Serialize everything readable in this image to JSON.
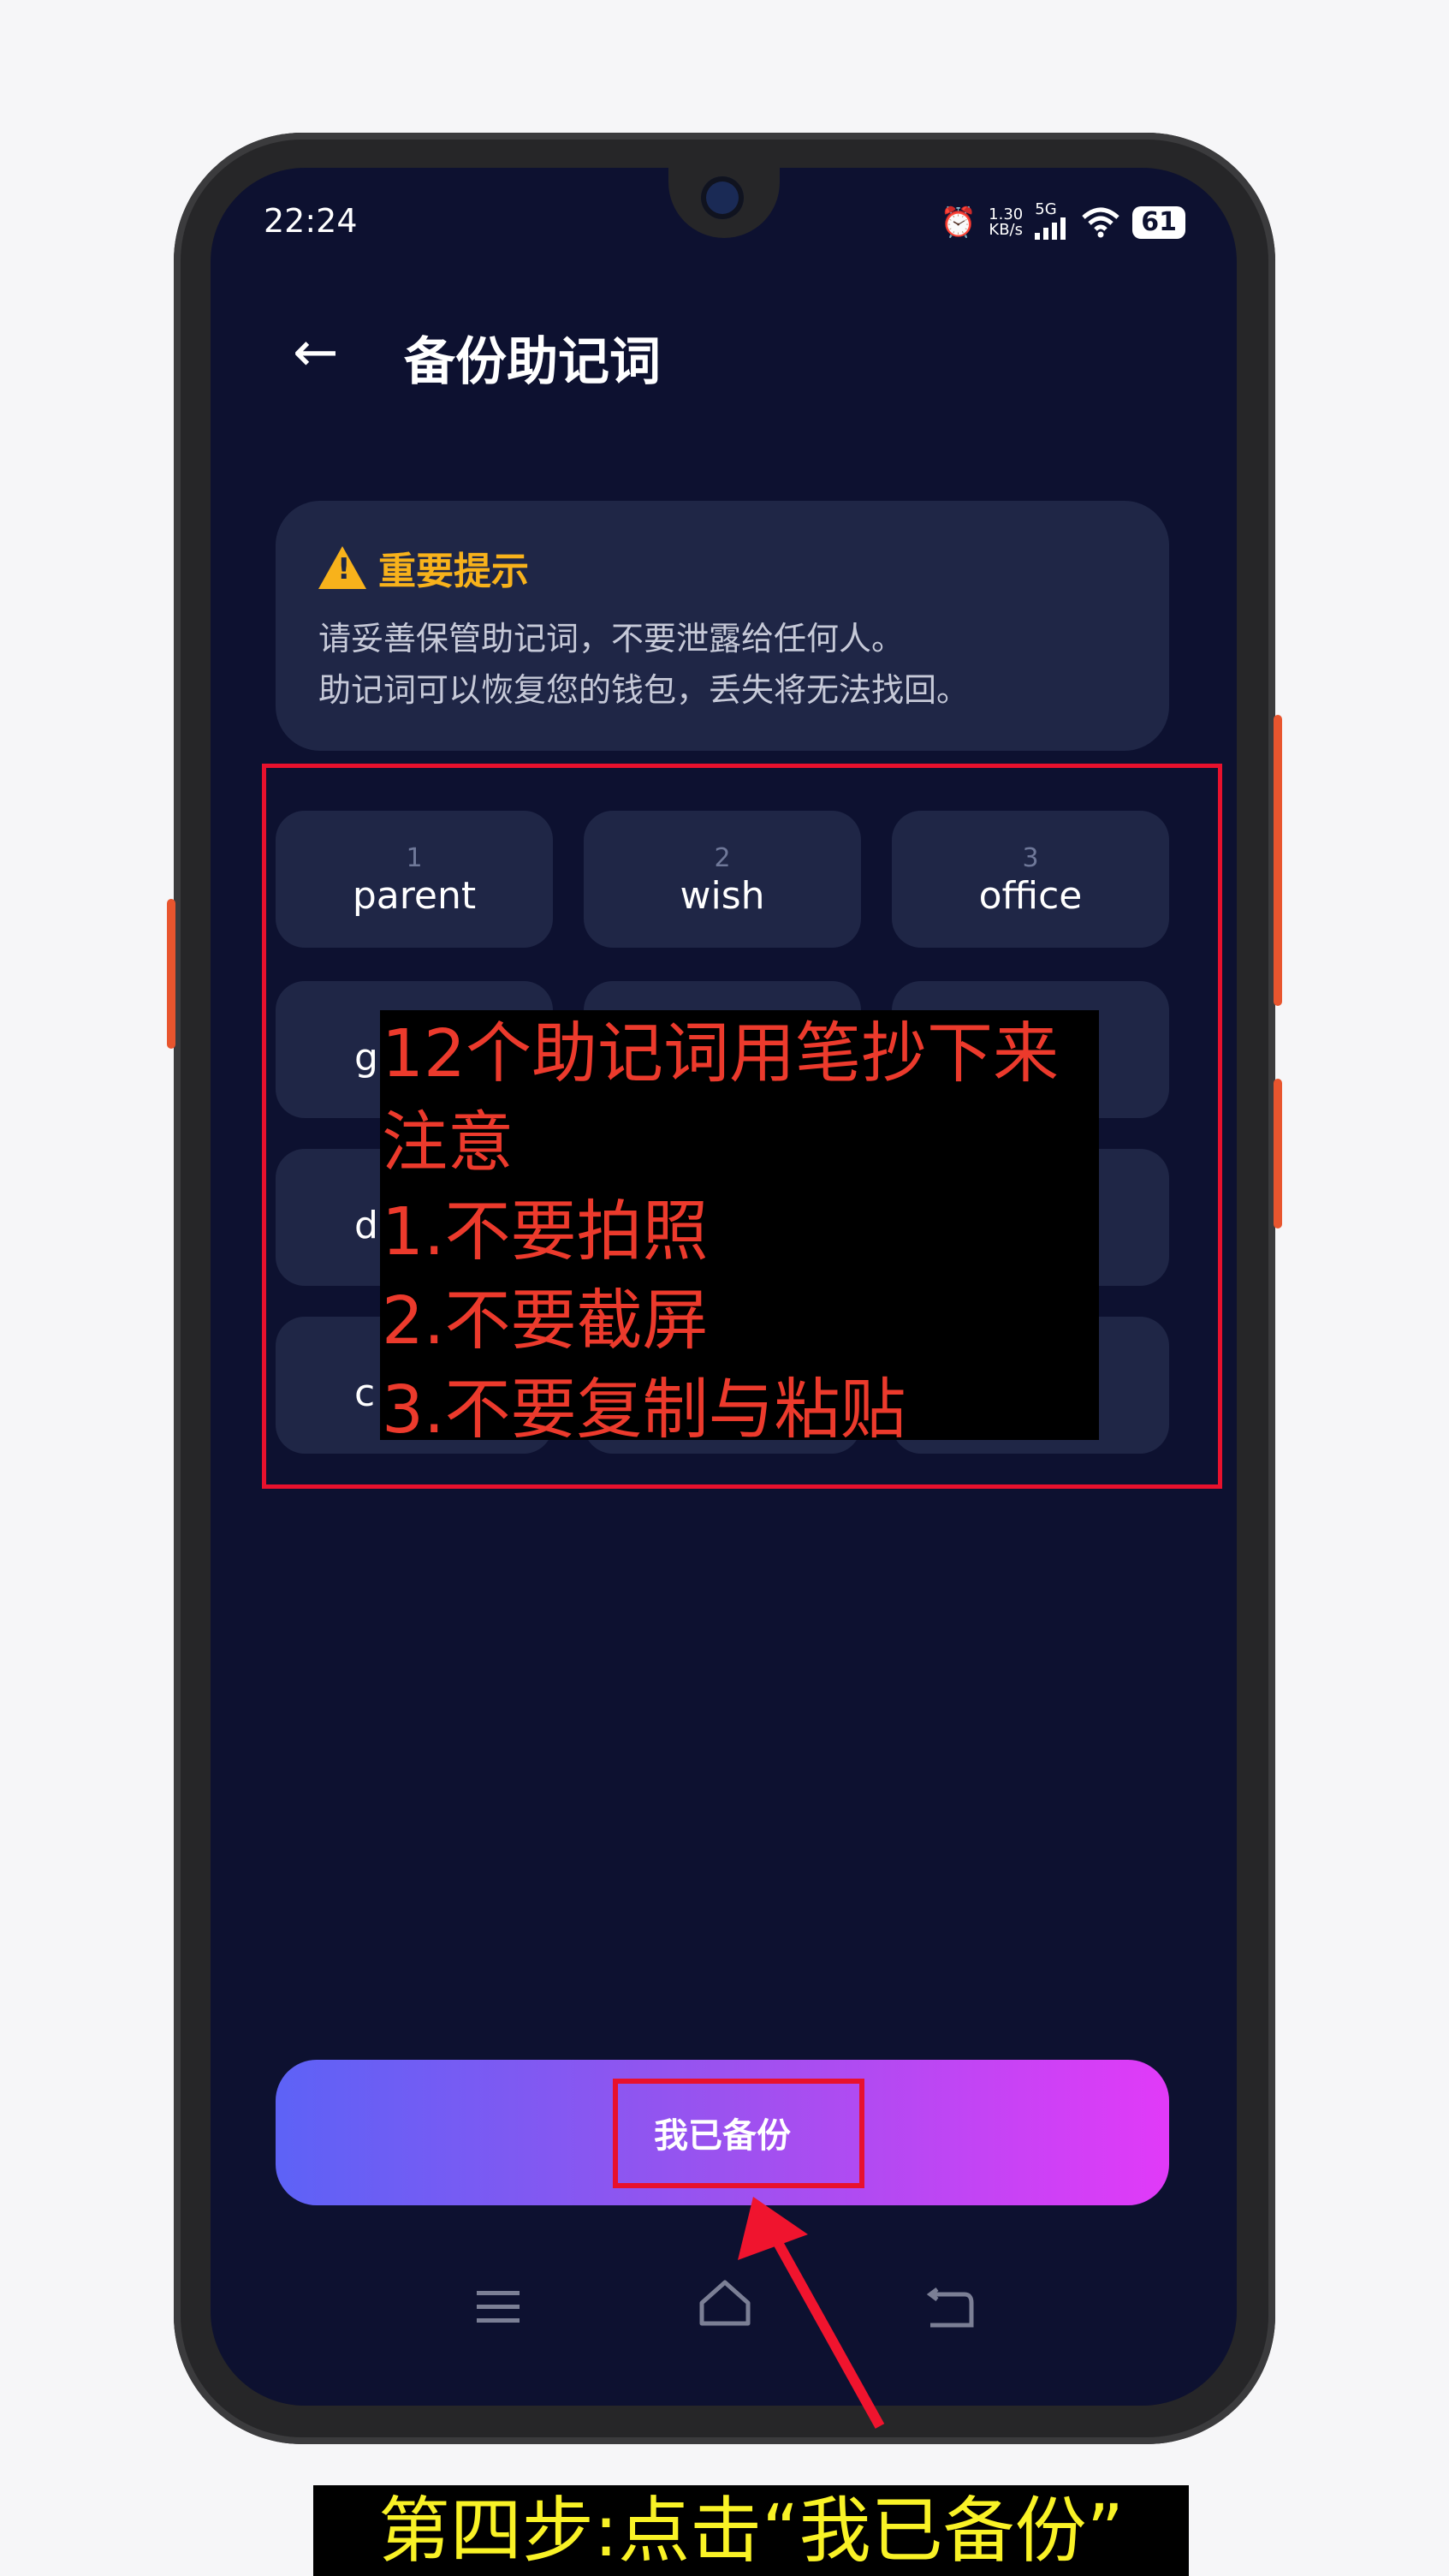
{
  "status_bar": {
    "time": "22:24",
    "network_speed_value": "1.30",
    "network_speed_unit": "KB/s",
    "network_type": "5G",
    "battery": "61"
  },
  "header": {
    "title": "备份助记词",
    "back_icon": "arrow-left-icon"
  },
  "notice": {
    "title": "重要提示",
    "line1": "请妥善保管助记词，不要泄露给任何人。",
    "line2": "助记词可以恢复您的钱包，丢失将无法找回。",
    "icon": "warning-icon",
    "title_color": "#f8b21b"
  },
  "mnemonic": {
    "words": [
      {
        "index": "1",
        "word": "parent"
      },
      {
        "index": "2",
        "word": "wish"
      },
      {
        "index": "3",
        "word": "office"
      }
    ],
    "partial_first_letters": [
      "g",
      "d",
      "c"
    ]
  },
  "overlay_note": {
    "lines": [
      "12个助记词用笔抄下来",
      "注意",
      "1.不要拍照",
      "2.不要截屏",
      "3.不要复制与粘贴"
    ],
    "text_color": "#ec3a2c"
  },
  "cta": {
    "label": "我已备份",
    "gradient_start": "#5d62f6",
    "gradient_end": "#e13af8"
  },
  "nav": {
    "menu_icon": "menu-icon",
    "home_icon": "home-icon",
    "back_icon": "back-icon"
  },
  "caption": {
    "text": "第四步:点击“我已备份”",
    "text_color": "#f9f226"
  },
  "highlight_color": "#e8112d"
}
